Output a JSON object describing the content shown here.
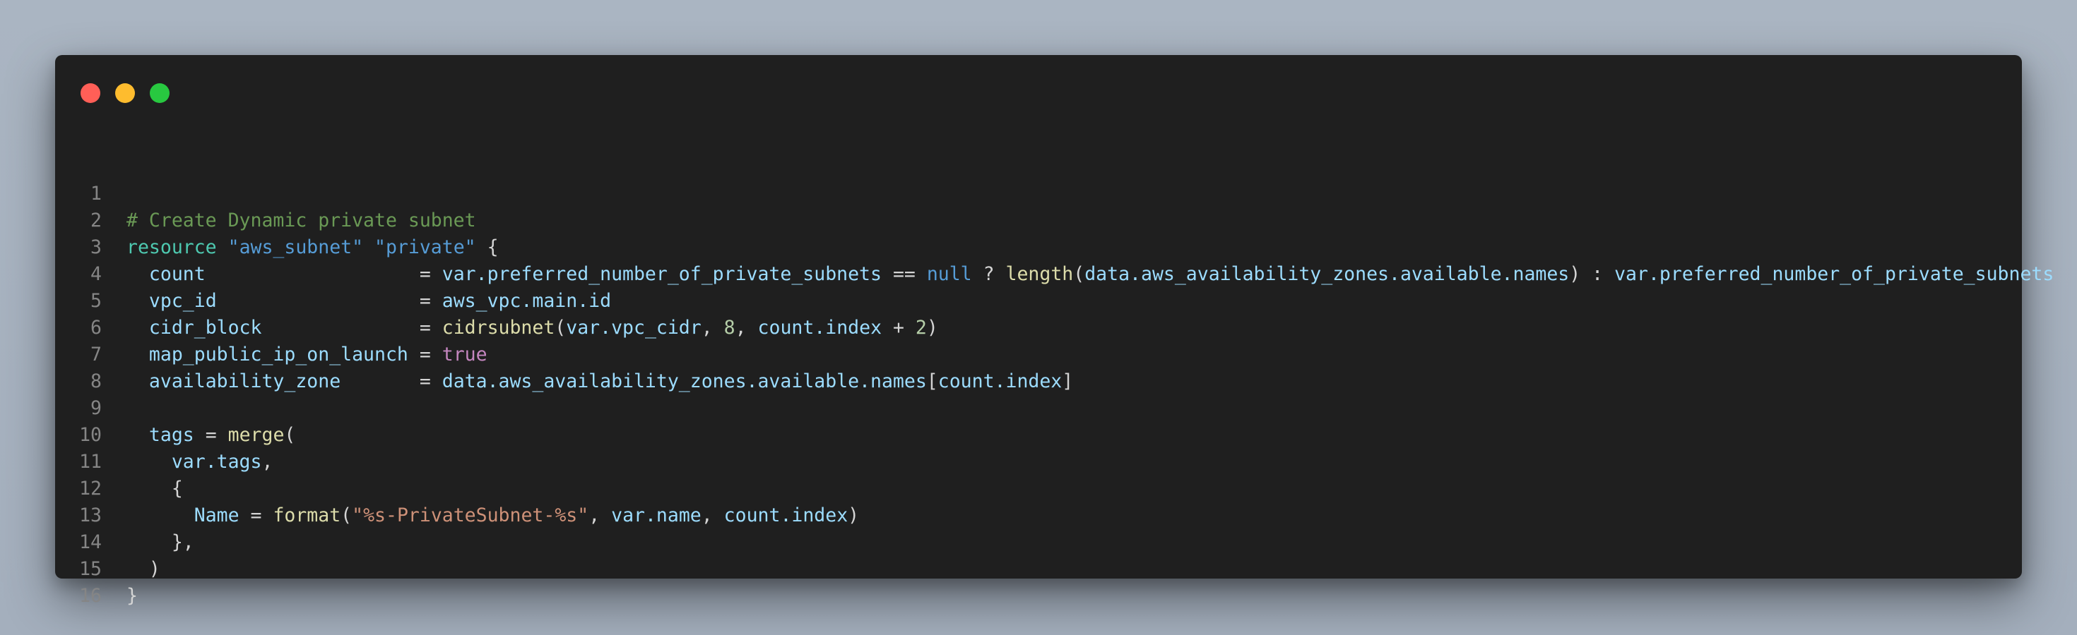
{
  "window": {
    "traffic_lights": [
      {
        "name": "close",
        "color": "#ff5f57"
      },
      {
        "name": "minimize",
        "color": "#febc2e"
      },
      {
        "name": "zoom",
        "color": "#28c840"
      }
    ]
  },
  "colors": {
    "background": "#a7b2bf",
    "window": "#1f1f1f",
    "comment": "#6a9955",
    "keyword": "#4ec9b0",
    "string": "#ce9178",
    "attribute": "#9cdcfe",
    "function": "#dcdcaa",
    "null": "#569cd6",
    "boolean": "#c586c0",
    "number": "#b5cea8",
    "line_number": "#858585"
  },
  "code": {
    "language": "hcl",
    "lines": [
      {
        "n": "1",
        "tokens": []
      },
      {
        "n": "2",
        "tokens": [
          {
            "t": "comment",
            "v": "# Create Dynamic private subnet"
          }
        ]
      },
      {
        "n": "3",
        "tokens": [
          {
            "t": "keyword",
            "v": "resource"
          },
          {
            "t": "plain",
            "v": " "
          },
          {
            "t": "string-blue",
            "v": "\"aws_subnet\""
          },
          {
            "t": "plain",
            "v": " "
          },
          {
            "t": "string-blue",
            "v": "\"private\""
          },
          {
            "t": "plain",
            "v": " {"
          }
        ]
      },
      {
        "n": "4",
        "tokens": [
          {
            "t": "plain",
            "v": "  "
          },
          {
            "t": "attr",
            "v": "count"
          },
          {
            "t": "plain",
            "v": "                   = "
          },
          {
            "t": "var",
            "v": "var.preferred_number_of_private_subnets"
          },
          {
            "t": "plain",
            "v": " == "
          },
          {
            "t": "null",
            "v": "null"
          },
          {
            "t": "plain",
            "v": " ? "
          },
          {
            "t": "func",
            "v": "length"
          },
          {
            "t": "plain",
            "v": "("
          },
          {
            "t": "var",
            "v": "data.aws_availability_zones.available.names"
          },
          {
            "t": "plain",
            "v": ") : "
          },
          {
            "t": "var",
            "v": "var.preferred_number_of_private_subnets"
          }
        ]
      },
      {
        "n": "5",
        "tokens": [
          {
            "t": "plain",
            "v": "  "
          },
          {
            "t": "attr",
            "v": "vpc_id"
          },
          {
            "t": "plain",
            "v": "                  = "
          },
          {
            "t": "var",
            "v": "aws_vpc.main.id"
          }
        ]
      },
      {
        "n": "6",
        "tokens": [
          {
            "t": "plain",
            "v": "  "
          },
          {
            "t": "attr",
            "v": "cidr_block"
          },
          {
            "t": "plain",
            "v": "              = "
          },
          {
            "t": "func",
            "v": "cidrsubnet"
          },
          {
            "t": "plain",
            "v": "("
          },
          {
            "t": "var",
            "v": "var.vpc_cidr"
          },
          {
            "t": "plain",
            "v": ", "
          },
          {
            "t": "number",
            "v": "8"
          },
          {
            "t": "plain",
            "v": ", "
          },
          {
            "t": "var",
            "v": "count.index"
          },
          {
            "t": "plain",
            "v": " + "
          },
          {
            "t": "number",
            "v": "2"
          },
          {
            "t": "plain",
            "v": ")"
          }
        ]
      },
      {
        "n": "7",
        "tokens": [
          {
            "t": "plain",
            "v": "  "
          },
          {
            "t": "attr",
            "v": "map_public_ip_on_launch"
          },
          {
            "t": "plain",
            "v": " = "
          },
          {
            "t": "bool",
            "v": "true"
          }
        ]
      },
      {
        "n": "8",
        "tokens": [
          {
            "t": "plain",
            "v": "  "
          },
          {
            "t": "attr",
            "v": "availability_zone"
          },
          {
            "t": "plain",
            "v": "       = "
          },
          {
            "t": "var",
            "v": "data.aws_availability_zones.available.names"
          },
          {
            "t": "plain",
            "v": "["
          },
          {
            "t": "var",
            "v": "count.index"
          },
          {
            "t": "plain",
            "v": "]"
          }
        ]
      },
      {
        "n": "9",
        "tokens": []
      },
      {
        "n": "10",
        "tokens": [
          {
            "t": "plain",
            "v": "  "
          },
          {
            "t": "attr",
            "v": "tags"
          },
          {
            "t": "plain",
            "v": " = "
          },
          {
            "t": "func",
            "v": "merge"
          },
          {
            "t": "plain",
            "v": "("
          }
        ]
      },
      {
        "n": "11",
        "tokens": [
          {
            "t": "plain",
            "v": "    "
          },
          {
            "t": "var",
            "v": "var.tags"
          },
          {
            "t": "plain",
            "v": ","
          }
        ]
      },
      {
        "n": "12",
        "tokens": [
          {
            "t": "plain",
            "v": "    {"
          }
        ]
      },
      {
        "n": "13",
        "tokens": [
          {
            "t": "plain",
            "v": "      "
          },
          {
            "t": "attr",
            "v": "Name"
          },
          {
            "t": "plain",
            "v": " = "
          },
          {
            "t": "func",
            "v": "format"
          },
          {
            "t": "plain",
            "v": "("
          },
          {
            "t": "string",
            "v": "\"%s-PrivateSubnet-%s\""
          },
          {
            "t": "plain",
            "v": ", "
          },
          {
            "t": "var",
            "v": "var.name"
          },
          {
            "t": "plain",
            "v": ", "
          },
          {
            "t": "var",
            "v": "count.index"
          },
          {
            "t": "plain",
            "v": ")"
          }
        ]
      },
      {
        "n": "14",
        "tokens": [
          {
            "t": "plain",
            "v": "    },"
          }
        ]
      },
      {
        "n": "15",
        "tokens": [
          {
            "t": "plain",
            "v": "  )"
          }
        ]
      },
      {
        "n": "16",
        "tokens": [
          {
            "t": "plain",
            "v": "}"
          }
        ]
      }
    ]
  }
}
